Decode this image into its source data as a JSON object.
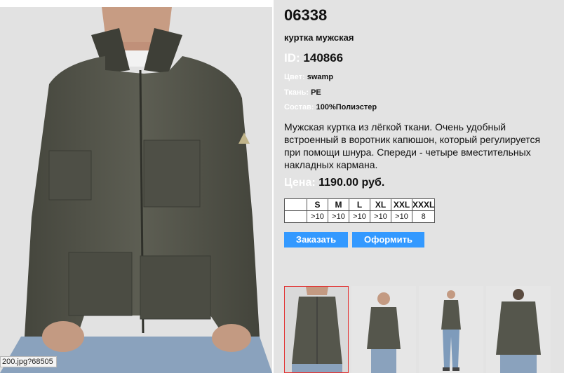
{
  "product": {
    "article": "06338",
    "type": "куртка мужская",
    "id_label": "ID:",
    "id_value": "140866",
    "color_label": "Цвет:",
    "color_value": "swamp",
    "fabric_label": "Ткань:",
    "fabric_value": "PE",
    "composition_label": "Состав:",
    "composition_value": "100%Полиэстер",
    "description": "Мужская куртка из лёгкой ткани. Очень удобный встроенный в воротник капюшон, который регулируется при помощи шнура. Спереди - четыре вместительных накладных кармана.",
    "price_label": "Цена:",
    "price_value": "1190.00 руб."
  },
  "sizes": {
    "headers": [
      "",
      "S",
      "M",
      "L",
      "XL",
      "XXL",
      "XXXL"
    ],
    "stock": [
      "",
      ">10",
      ">10",
      ">10",
      ">10",
      ">10",
      "8"
    ]
  },
  "buttons": {
    "order": "Заказать",
    "checkout": "Оформить"
  },
  "status_bar": "200.jpg?68505",
  "colors": {
    "panel_bg": "#e3e3e3",
    "button_bg": "#3399ff",
    "jacket": "#55564c",
    "selected_border": "#e23333"
  }
}
